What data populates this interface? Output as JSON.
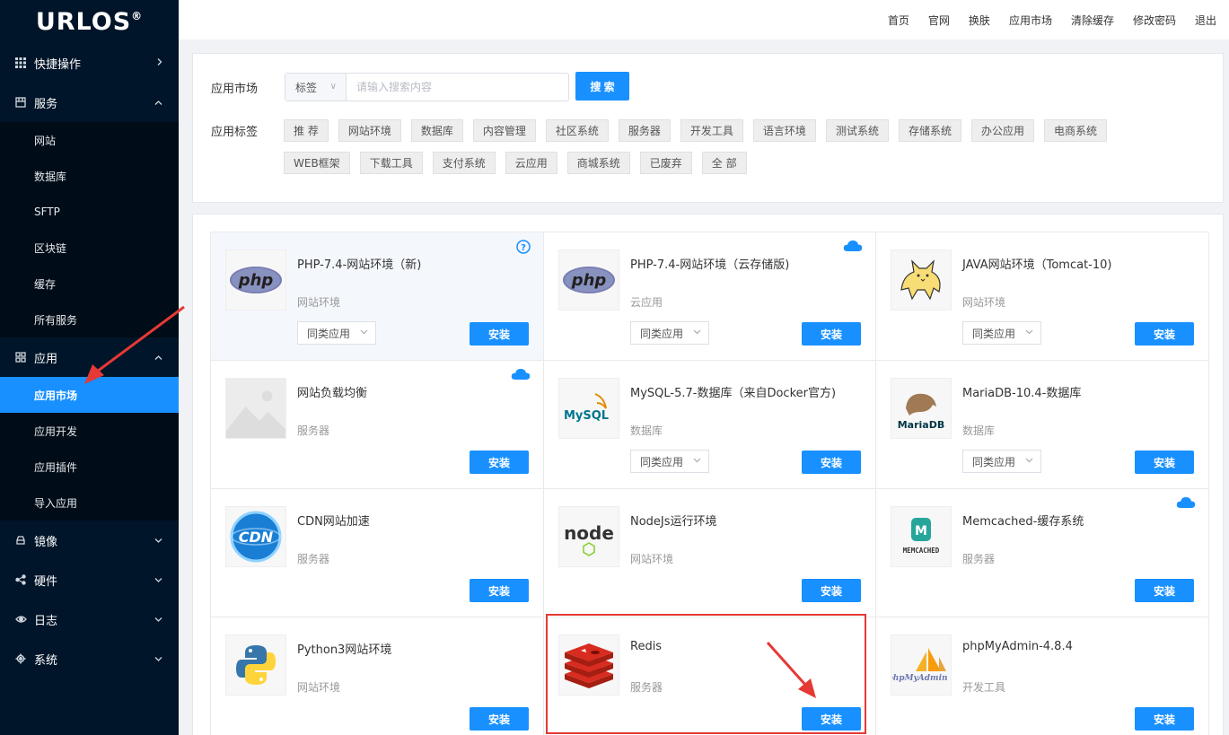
{
  "brand": {
    "name": "URLOS",
    "mark": "®"
  },
  "topnav": [
    "首页",
    "官网",
    "换肤",
    "应用市场",
    "清除缓存",
    "修改密码",
    "退出"
  ],
  "sidebar": {
    "groups": [
      {
        "label": "快捷操作",
        "icon": "grid-icon",
        "expanded": false,
        "items": []
      },
      {
        "label": "服务",
        "icon": "server-icon",
        "expanded": true,
        "items": [
          "网站",
          "数据库",
          "SFTP",
          "区块链",
          "缓存",
          "所有服务"
        ]
      },
      {
        "label": "应用",
        "icon": "apps-icon",
        "expanded": true,
        "items": [
          "应用市场",
          "应用开发",
          "应用插件",
          "导入应用"
        ],
        "active": "应用市场"
      },
      {
        "label": "镜像",
        "icon": "disk-icon",
        "expanded": false,
        "items": []
      },
      {
        "label": "硬件",
        "icon": "share-icon",
        "expanded": false,
        "items": []
      },
      {
        "label": "日志",
        "icon": "eye-icon",
        "expanded": false,
        "items": []
      },
      {
        "label": "系统",
        "icon": "gear-icon",
        "expanded": false,
        "items": []
      }
    ]
  },
  "search": {
    "label": "应用市场",
    "select_value": "标签",
    "placeholder": "请输入搜索内容",
    "button": "搜 索"
  },
  "tags": {
    "label": "应用标签",
    "items": [
      "推 荐",
      "网站环境",
      "数据库",
      "内容管理",
      "社区系统",
      "服务器",
      "开发工具",
      "语言环境",
      "测试系统",
      "存储系统",
      "办公应用",
      "电商系统",
      "WEB框架",
      "下载工具",
      "支付系统",
      "云应用",
      "商城系统",
      "已废弃",
      "全 部"
    ]
  },
  "install_label": "安装",
  "similar_label": "同类应用",
  "apps": [
    {
      "name": "PHP-7.4-网站环境（新)",
      "category": "网站环境",
      "logo": "php-logo",
      "badge": "help-icon",
      "similar": true,
      "hover": true
    },
    {
      "name": "PHP-7.4-网站环境（云存储版)",
      "category": "云应用",
      "logo": "php-logo",
      "badge": "cloud-icon",
      "similar": true
    },
    {
      "name": "JAVA网站环境（Tomcat-10)",
      "category": "网站环境",
      "logo": "tomcat-logo",
      "badge": "",
      "similar": true
    },
    {
      "name": "网站负载均衡",
      "category": "服务器",
      "logo": "placeholder-image",
      "badge": "cloud-icon",
      "similar": false
    },
    {
      "name": "MySQL-5.7-数据库（来自Docker官方)",
      "category": "数据库",
      "logo": "mysql-logo",
      "badge": "",
      "similar": true
    },
    {
      "name": "MariaDB-10.4-数据库",
      "category": "数据库",
      "logo": "mariadb-logo",
      "badge": "",
      "similar": true
    },
    {
      "name": "CDN网站加速",
      "category": "服务器",
      "logo": "cdn-logo",
      "badge": "",
      "similar": false
    },
    {
      "name": "NodeJs运行环境",
      "category": "网站环境",
      "logo": "node-logo",
      "badge": "",
      "similar": false
    },
    {
      "name": "Memcached-缓存系统",
      "category": "服务器",
      "logo": "memcached-logo",
      "badge": "cloud-icon",
      "similar": false
    },
    {
      "name": "Python3网站环境",
      "category": "网站环境",
      "logo": "python-logo",
      "badge": "",
      "similar": false
    },
    {
      "name": "Redis",
      "category": "服务器",
      "logo": "redis-logo",
      "badge": "",
      "similar": false,
      "highlighted": true
    },
    {
      "name": "phpMyAdmin-4.8.4",
      "category": "开发工具",
      "logo": "phpmyadmin-logo",
      "badge": "",
      "similar": false
    }
  ],
  "logo_text": {
    "php": "php",
    "mysql": "MySQL",
    "mariadb": "MariaDB",
    "cdn": "CDN",
    "node": "node",
    "memcached": "MEMCACHED",
    "phpmyadmin": "phpMyAdmin"
  },
  "colors": {
    "primary": "#1890ff",
    "sidebar_bg": "#001529",
    "annotation_red": "#e53935"
  }
}
